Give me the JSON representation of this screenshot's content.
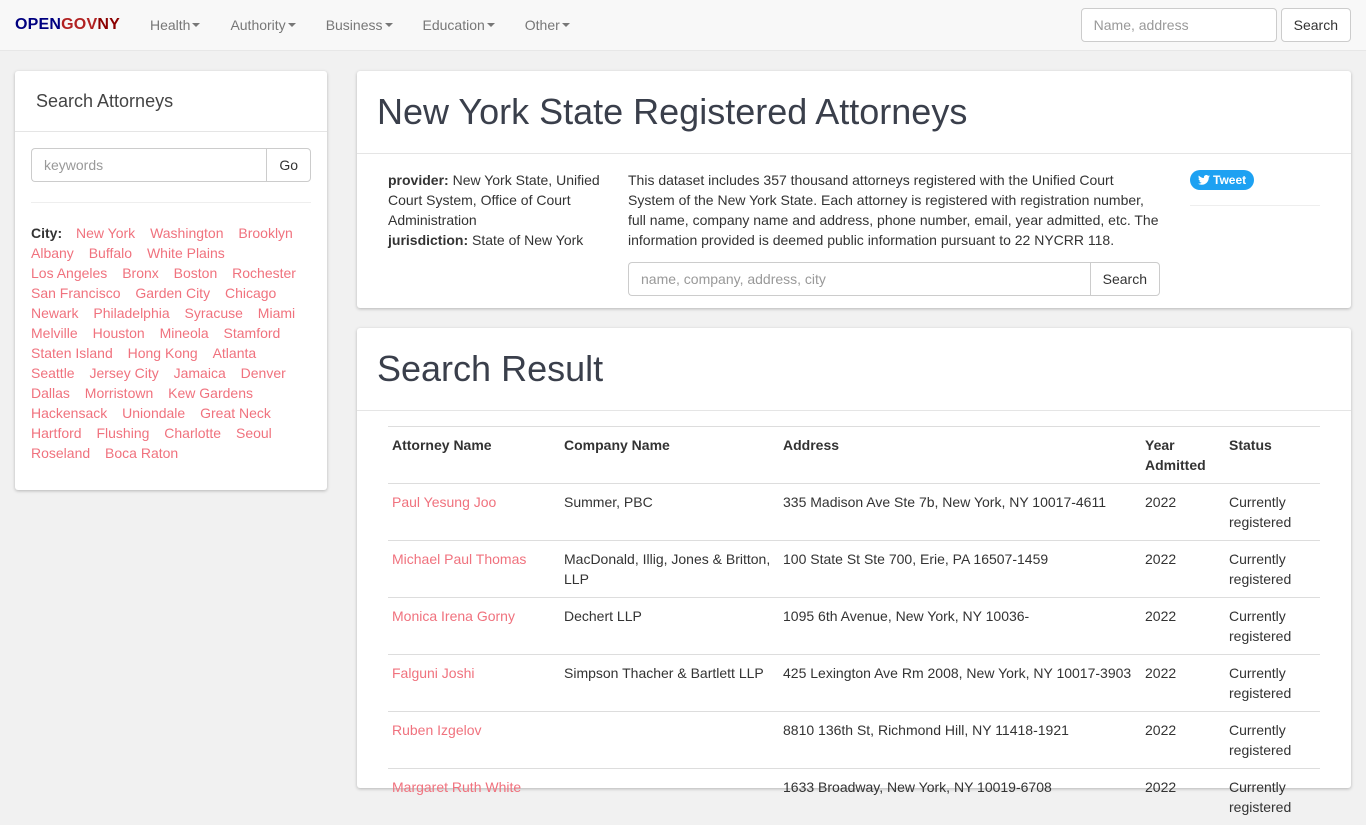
{
  "navbar": {
    "brand": {
      "part1": "OPEN",
      "part2": "GOV",
      "part3": "NY"
    },
    "items": [
      {
        "label": "Health"
      },
      {
        "label": "Authority"
      },
      {
        "label": "Business"
      },
      {
        "label": "Education"
      },
      {
        "label": "Other"
      }
    ],
    "search_placeholder": "Name, address",
    "search_button": "Search"
  },
  "sidebar": {
    "title": "Search Attorneys",
    "keywords_placeholder": "keywords",
    "go_button": "Go",
    "city_label": "City:",
    "cities": [
      "New York",
      "Washington",
      "Brooklyn",
      "Albany",
      "Buffalo",
      "White Plains",
      "Los Angeles",
      "Bronx",
      "Boston",
      "Rochester",
      "San Francisco",
      "Garden City",
      "Chicago",
      "Newark",
      "Philadelphia",
      "Syracuse",
      "Miami",
      "Melville",
      "Houston",
      "Mineola",
      "Stamford",
      "Staten Island",
      "Hong Kong",
      "Atlanta",
      "Seattle",
      "Jersey City",
      "Jamaica",
      "Denver",
      "Dallas",
      "Morristown",
      "Kew Gardens",
      "Hackensack",
      "Uniondale",
      "Great Neck",
      "Hartford",
      "Flushing",
      "Charlotte",
      "Seoul",
      "Roseland",
      "Boca Raton"
    ]
  },
  "info": {
    "title": "New York State Registered Attorneys",
    "provider_label": "provider:",
    "provider_value": "New York State, Unified Court System, Office of Court Administration",
    "jurisdiction_label": "jurisdiction:",
    "jurisdiction_value": "State of New York",
    "description": "This dataset includes 357 thousand attorneys registered with the Unified Court System of the New York State. Each attorney is registered with registration number, full name, company name and address, phone number, email, year admitted, etc. The information provided is deemed public information pursuant to 22 NYCRR 118.",
    "search_placeholder": "name, company, address, city",
    "search_button": "Search",
    "tweet_label": "Tweet"
  },
  "results": {
    "title": "Search Result",
    "columns": [
      "Attorney Name",
      "Company Name",
      "Address",
      "Year Admitted",
      "Status"
    ],
    "rows": [
      {
        "name": "Paul Yesung Joo",
        "company": "Summer, PBC",
        "address": "335 Madison Ave Ste 7b, New York, NY 10017-4611",
        "year": "2022",
        "status": "Currently registered"
      },
      {
        "name": "Michael Paul Thomas",
        "company": "MacDonald, Illig, Jones & Britton, LLP",
        "address": "100 State St Ste 700, Erie, PA 16507-1459",
        "year": "2022",
        "status": "Currently registered"
      },
      {
        "name": "Monica Irena Gorny",
        "company": "Dechert LLP",
        "address": "1095 6th Avenue, New York, NY 10036-",
        "year": "2022",
        "status": "Currently registered"
      },
      {
        "name": "Falguni Joshi",
        "company": "Simpson Thacher & Bartlett LLP",
        "address": "425 Lexington Ave Rm 2008, New York, NY 10017-3903",
        "year": "2022",
        "status": "Currently registered"
      },
      {
        "name": "Ruben Izgelov",
        "company": "",
        "address": "8810 136th St, Richmond Hill, NY 11418-1921",
        "year": "2022",
        "status": "Currently registered"
      },
      {
        "name": "Margaret Ruth White",
        "company": "",
        "address": "1633 Broadway, New York, NY 10019-6708",
        "year": "2022",
        "status": "Currently registered"
      }
    ]
  }
}
